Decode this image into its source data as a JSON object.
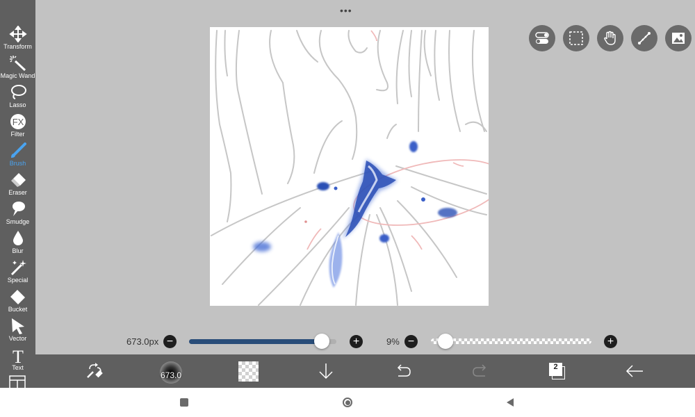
{
  "toolbar": {
    "tools": [
      {
        "label": "Transform",
        "icon": "transform-icon"
      },
      {
        "label": "Magic Wand",
        "icon": "magic-wand-icon"
      },
      {
        "label": "Lasso",
        "icon": "lasso-icon"
      },
      {
        "label": "Filter",
        "icon": "fx-icon",
        "glyph": "FX"
      },
      {
        "label": "Brush",
        "icon": "brush-icon",
        "active": true
      },
      {
        "label": "Eraser",
        "icon": "eraser-icon"
      },
      {
        "label": "Smudge",
        "icon": "smudge-icon"
      },
      {
        "label": "Blur",
        "icon": "blur-drop-icon"
      },
      {
        "label": "Special",
        "icon": "special-sparkle-icon"
      },
      {
        "label": "Bucket",
        "icon": "bucket-icon"
      },
      {
        "label": "Vector",
        "icon": "vector-arrow-icon"
      },
      {
        "label": "Text",
        "icon": "text-icon",
        "glyph": "T"
      }
    ],
    "active_color": "#4aa3f0"
  },
  "top_menu": {
    "icon": "more-dots-icon",
    "glyph": "•••"
  },
  "top_right_buttons": [
    {
      "icon": "toggle-settings-icon"
    },
    {
      "icon": "selection-icon"
    },
    {
      "icon": "hand-icon"
    },
    {
      "icon": "ruler-icon"
    },
    {
      "icon": "image-icon"
    }
  ],
  "brush_size": {
    "value_label": "673.0px",
    "fraction": 0.9,
    "fill_color": "#294d79"
  },
  "opacity": {
    "value_label": "9%",
    "fraction": 0.09
  },
  "bottom_bar": {
    "brush_size_label": "673.0",
    "layer_count": "2",
    "icons": [
      "tool-swap-icon",
      "brush-preview",
      "color-swatch",
      "download-arrow-icon",
      "undo-icon",
      "redo-icon",
      "layers-icon",
      "back-arrow-icon"
    ]
  },
  "system_nav": {
    "icons": [
      "recent-apps-icon",
      "home-icon",
      "back-nav-icon"
    ]
  }
}
